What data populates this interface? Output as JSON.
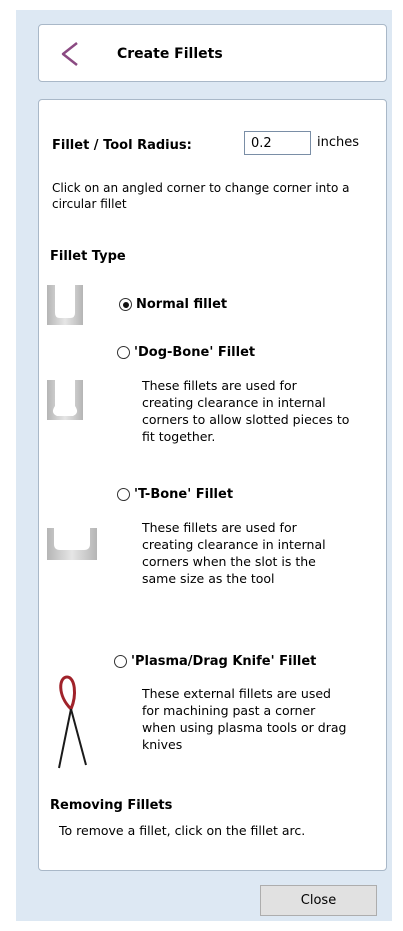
{
  "header": {
    "title": "Create Fillets"
  },
  "radius": {
    "label": "Fillet / Tool Radius:",
    "value": "0.2",
    "unit": "inches"
  },
  "instructions": "Click on an angled corner to change corner into a circular fillet",
  "fillet_type": {
    "title": "Fillet Type",
    "options": [
      {
        "label": "Normal fillet",
        "checked": true,
        "description": ""
      },
      {
        "label": "'Dog-Bone' Fillet",
        "checked": false,
        "description": "These fillets are used for creating clearance in internal corners to allow slotted pieces to fit together."
      },
      {
        "label": "'T-Bone' Fillet",
        "checked": false,
        "description": "These fillets are used for creating clearance in internal corners when the slot is the same size as the tool"
      },
      {
        "label": "'Plasma/Drag Knife' Fillet",
        "checked": false,
        "description": "These external fillets are used for machining past a corner when using plasma tools or drag knives"
      }
    ]
  },
  "removing": {
    "title": "Removing Fillets",
    "text": "To remove a fillet, click on the fillet arc."
  },
  "close_label": "Close",
  "colors": {
    "panel_bg": "#dde8f3",
    "back_arrow": "#8b4a82",
    "plasma_loop": "#a0222a"
  }
}
